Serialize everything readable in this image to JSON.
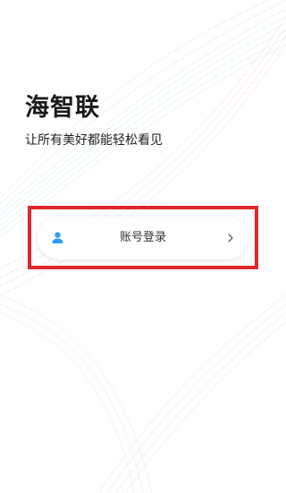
{
  "app": {
    "title": "海智联",
    "slogan": "让所有美好都能轻松看见"
  },
  "login": {
    "label": "账号登录",
    "icon": "user-icon",
    "chevron_icon": "chevron-right-icon"
  },
  "colors": {
    "highlight_frame": "#e0262d",
    "icon_blue": "#2d9cf5",
    "wave_blue": "#9fd3f0",
    "wave_pink": "#f3b3c3"
  }
}
